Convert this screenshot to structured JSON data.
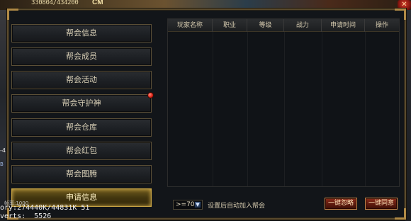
{
  "hud": {
    "hp_readout": "330804/434200",
    "badge": "CM",
    "close_glyph": "✕"
  },
  "side_labels": {
    "a": "-4",
    "b": "B"
  },
  "menu": {
    "items": [
      {
        "label": "帮会信息"
      },
      {
        "label": "帮会成员"
      },
      {
        "label": "帮会活动"
      },
      {
        "label": "帮会守护神"
      },
      {
        "label": "帮会仓库"
      },
      {
        "label": "帮会红包"
      },
      {
        "label": "帮会图腾"
      },
      {
        "label": "申请信息"
      }
    ],
    "active_index": 7,
    "notification_on": "帮会守护神"
  },
  "table": {
    "columns": [
      "玩家名称",
      "职业",
      "等级",
      "战力",
      "申请时间",
      "操作"
    ],
    "rows": []
  },
  "footer": {
    "level_filter": ">=70",
    "dropdown_glyph": "▼",
    "auto_join_label": "设置后自动加入帮会",
    "ignore_all_button": "一键忽略",
    "accept_all_button": "一键同意"
  },
  "debug": {
    "small": "帧率:1000",
    "memory": "ory:274440K/44831K 51",
    "verts": "verts:  5526"
  },
  "colors": {
    "panel_border": "#5a4a2c",
    "active_tab": "#c9a444",
    "button_red": "#8a2a18",
    "notification_dot": "#e0281a"
  }
}
